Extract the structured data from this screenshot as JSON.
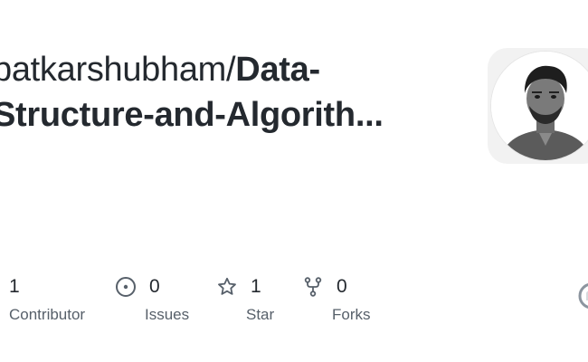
{
  "repo_card": {
    "owner": "patkarshubham/",
    "repo_line1": "Data-",
    "repo_line2": "Structure-and-Algorith..."
  },
  "stats": {
    "contributors": {
      "value": "1",
      "label": "Contributor"
    },
    "issues": {
      "value": "0",
      "label": "Issues"
    },
    "stars": {
      "value": "1",
      "label": "Star"
    },
    "forks": {
      "value": "0",
      "label": "Forks"
    }
  },
  "icons": {
    "issues": "issue-opened-icon",
    "stars": "star-icon",
    "forks": "fork-icon",
    "brand": "github-logo-icon"
  },
  "colors": {
    "title": "#24292f",
    "muted": "#57606a",
    "icon": "#57606a"
  }
}
